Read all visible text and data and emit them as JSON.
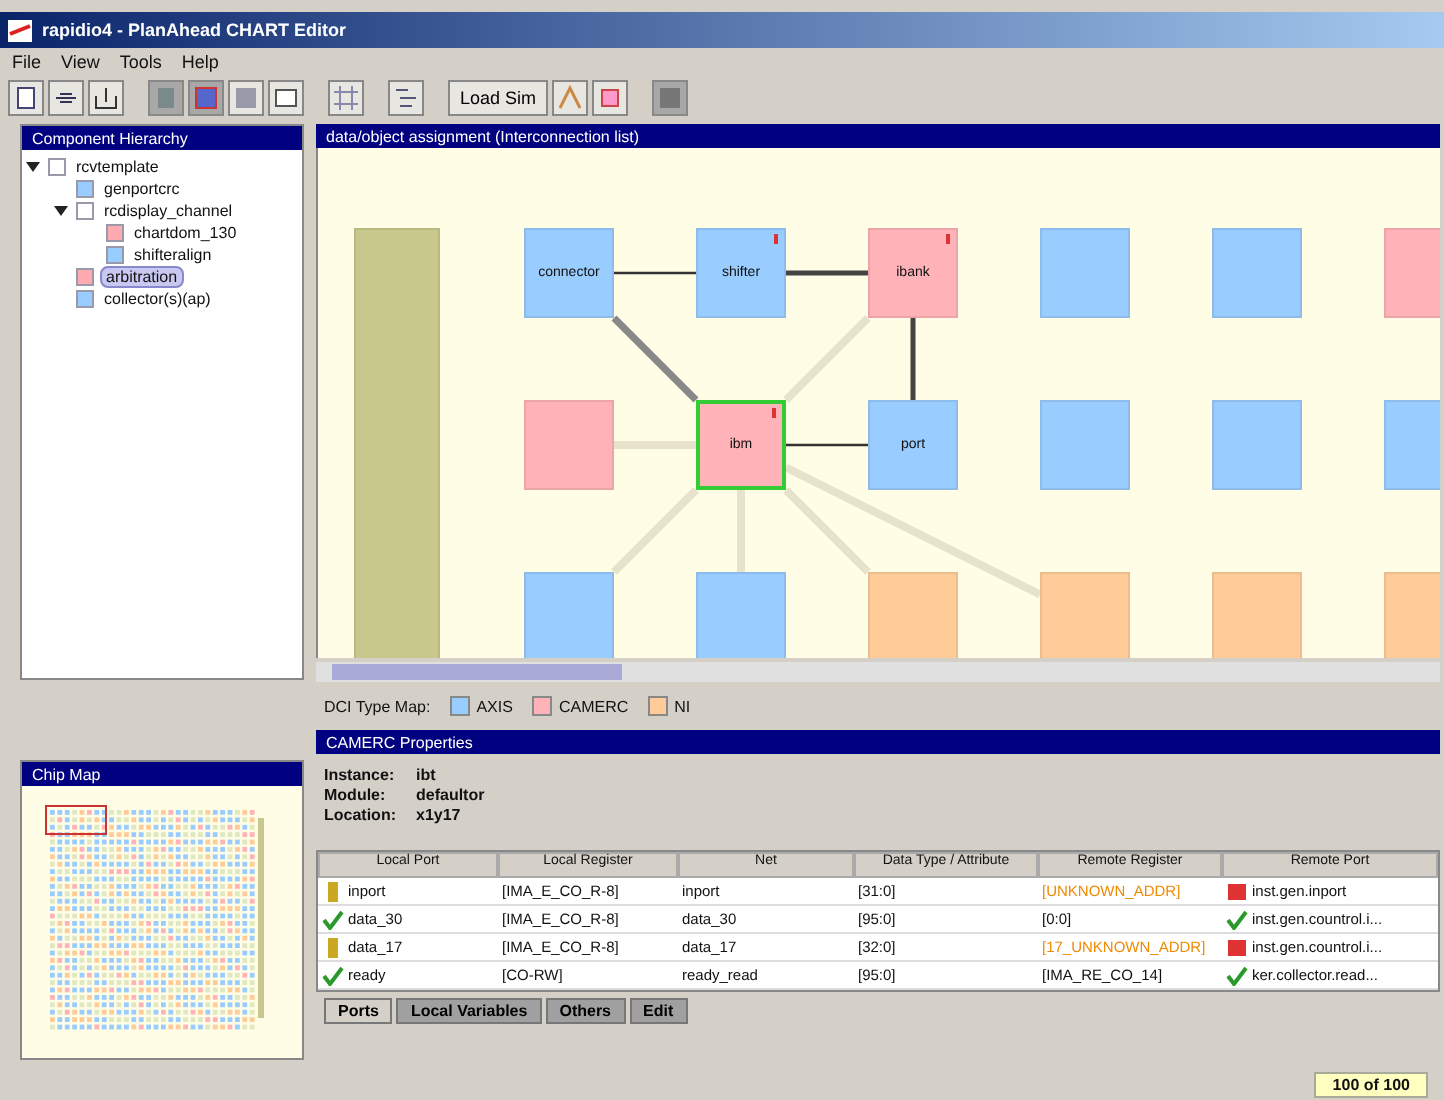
{
  "window": {
    "title": "rapidio4 - PlanAhead CHART Editor"
  },
  "menu": [
    "File",
    "View",
    "Tools",
    "Help"
  ],
  "toolbar": {
    "load_button": "Load Sim"
  },
  "hierarchy": {
    "title": "Component Hierarchy",
    "items": [
      {
        "label": "rcvtemplate",
        "color": "#ffffff",
        "expanded": true,
        "selected": false,
        "children": [
          {
            "label": "genportcrc",
            "color": "#99ccff",
            "selected": false
          },
          {
            "label": "rcdisplay_channel",
            "color": "#ffffff",
            "expanded": true,
            "selected": false,
            "children": [
              {
                "label": "chartdom_130",
                "color": "#ffaab0",
                "selected": false
              },
              {
                "label": "shifteralign",
                "color": "#99ccff",
                "selected": false
              }
            ]
          },
          {
            "label": "arbitration",
            "color": "#ffaab0",
            "selected": true
          },
          {
            "label": "collector(s)(ap)",
            "color": "#99ccff",
            "selected": false
          }
        ]
      }
    ]
  },
  "chip_map": {
    "title": "Chip Map"
  },
  "canvas": {
    "title": "data/object assignment (Interconnection list)",
    "grid": [
      {
        "cells": [
          {
            "label": "connector",
            "color": "#99ccff",
            "selected": false,
            "flag": false
          },
          {
            "label": "shifter",
            "color": "#99ccff",
            "selected": false,
            "flag": true
          },
          {
            "label": "ibank",
            "color": "#ffb3b8",
            "selected": false,
            "flag": true
          },
          {
            "color": "#99ccff",
            "selected": false,
            "flag": false
          },
          {
            "color": "#99ccff",
            "selected": false,
            "flag": false
          },
          {
            "color": "#ffb3b8",
            "selected": false,
            "flag": false
          }
        ]
      },
      {
        "cells": [
          {
            "color": "#ffb3b8",
            "selected": false,
            "flag": false
          },
          {
            "label": "ibm",
            "color": "#ffb3b8",
            "selected": true,
            "flag": true
          },
          {
            "label": "port",
            "color": "#99ccff",
            "selected": false,
            "flag": false
          },
          {
            "color": "#99ccff",
            "selected": false,
            "flag": false
          },
          {
            "color": "#99ccff",
            "selected": false,
            "flag": false
          },
          {
            "color": "#99ccff",
            "selected": false,
            "flag": false
          }
        ]
      },
      {
        "cells": [
          {
            "color": "#99ccff",
            "selected": false,
            "flag": false
          },
          {
            "color": "#99ccff",
            "selected": false,
            "flag": false
          },
          {
            "color": "#ffcc99",
            "selected": false,
            "flag": false
          },
          {
            "color": "#ffcc99",
            "selected": false,
            "flag": false
          },
          {
            "color": "#ffcc99",
            "selected": false,
            "flag": false
          },
          {
            "color": "#ffcc99",
            "selected": false,
            "flag": false
          }
        ]
      }
    ]
  },
  "legend": {
    "label": "DCI Type Map:",
    "items": [
      {
        "label": "AXIS",
        "color": "#99ccff"
      },
      {
        "label": "CAMERC",
        "color": "#ffb3b8"
      },
      {
        "label": "NI",
        "color": "#ffcc99"
      }
    ]
  },
  "properties": {
    "title": "CAMERC Properties",
    "fields": [
      {
        "label": "Instance:",
        "value": "ibt"
      },
      {
        "label": "Module:",
        "value": "defaultor"
      },
      {
        "label": "Location:",
        "value": "x1y17"
      }
    ]
  },
  "table": {
    "columns": [
      "Local Port",
      "Local Register",
      "Net",
      "Data Type / Attribute",
      "Remote Register",
      "Remote Port"
    ],
    "rows": [
      {
        "ok": false,
        "cells": [
          "inport",
          "[IMA_E_CO_R-8]",
          "inport",
          "[31:0]",
          "[UNKNOWN_ADDR]",
          "inst.gen.inport"
        ],
        "remote_ok": false,
        "remote_unknown": true
      },
      {
        "ok": true,
        "cells": [
          "data_30",
          "[IMA_E_CO_R-8]",
          "data_30",
          "[95:0]",
          "[0:0]",
          "inst.gen.countrol.i..."
        ],
        "remote_ok": true,
        "remote_unknown": false
      },
      {
        "ok": false,
        "cells": [
          "data_17",
          "[IMA_E_CO_R-8]",
          "data_17",
          "[32:0]",
          "[17_UNKNOWN_ADDR]",
          "inst.gen.countrol.i..."
        ],
        "remote_ok": false,
        "remote_unknown": true
      },
      {
        "ok": true,
        "cells": [
          "ready",
          "[CO-RW]",
          "ready_read",
          "[95:0]",
          "[IMA_RE_CO_14]",
          "ker.collector.read..."
        ],
        "remote_ok": true,
        "remote_unknown": false
      }
    ]
  },
  "tabs": [
    {
      "label": "Ports",
      "selected": true
    },
    {
      "label": "Local Variables",
      "selected": false
    },
    {
      "label": "Others",
      "selected": false
    },
    {
      "label": "Edit",
      "selected": false
    }
  ],
  "status_bar": {
    "count": "100 of 100"
  }
}
